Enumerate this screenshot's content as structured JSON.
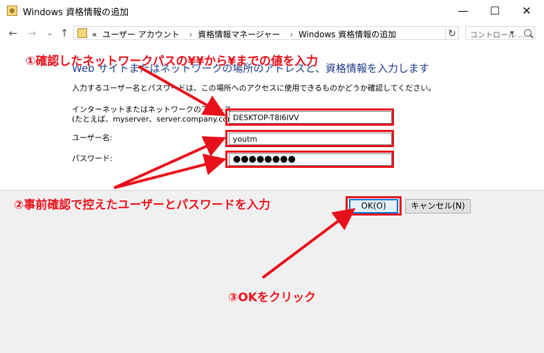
{
  "window": {
    "title": "Windows 資格情報の追加",
    "minimize": "—",
    "maximize": "☐",
    "close": "✕"
  },
  "address": {
    "back": "←",
    "forward": "→",
    "recent": "⌄",
    "up": "↑",
    "overflow": "«",
    "crumbs": [
      "ユーザー アカウント",
      "資格情報マネージャー",
      "Windows 資格情報の追加"
    ],
    "separator": "›",
    "refresh": "↻",
    "search_placeholder": "コントロール ..."
  },
  "form": {
    "heading": "Web サイトまたはネットワークの場所のアドレスと、資格情報を入力します",
    "description": "入力するユーザー名とパスワードは、この場所へのアクセスに使用できるものかどうか確認してください。",
    "address_label_line1": "インターネットまたはネットワークのアドレス",
    "address_label_line2": "(たとえば、myserver、server.company.com):",
    "address_value": "DESKTOP-T8l6IVV",
    "username_label": "ユーザー名:",
    "username_value": "youtm",
    "password_label": "パスワード:",
    "password_value": "●●●●●●●●",
    "ok_button": "OK(O)",
    "cancel_button": "キャンセル(N)"
  },
  "annotations": {
    "step1": "①確認したネットワークパスの¥¥から¥までの値を入力",
    "step2": "②事前確認で控えたユーザーとパスワードを入力",
    "step3": "③OKをクリック"
  },
  "colors": {
    "annotation_red": "#e8101a",
    "heading_blue": "#1e3a8a",
    "ok_border": "#0078d7"
  }
}
